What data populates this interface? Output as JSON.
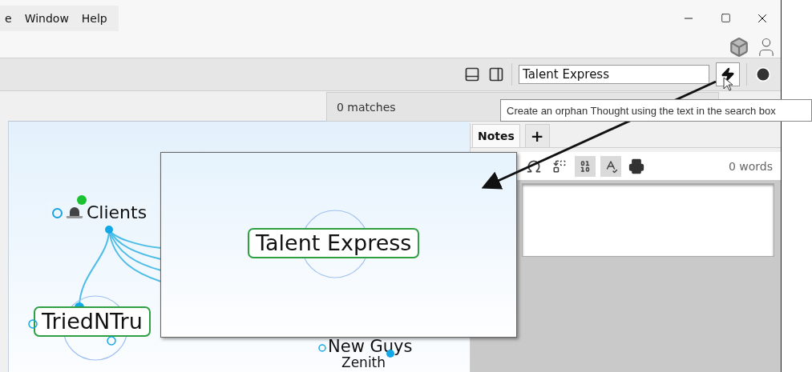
{
  "menu": [
    {
      "label": "e"
    },
    {
      "label": "Window"
    },
    {
      "label": "Help"
    }
  ],
  "search": {
    "value": "Talent Express"
  },
  "search_results": {
    "text": "0 matches"
  },
  "tooltip": {
    "text": "Create an orphan Thought using the text in the search box"
  },
  "notes": {
    "tabs": [
      {
        "label": "Notes",
        "selected": true
      },
      {
        "label": "+",
        "selected": false
      }
    ],
    "word_count": "0 words"
  },
  "map": {
    "nodes": [
      {
        "label": "Clients",
        "kind": "tagged"
      },
      {
        "label": "TriedNTru",
        "kind": "boxed"
      },
      {
        "label": "New Guys",
        "kind": "plain"
      },
      {
        "label": "Zenith",
        "kind": "plain"
      }
    ]
  },
  "zoom_callout": {
    "node": {
      "label": "Talent Express"
    }
  }
}
